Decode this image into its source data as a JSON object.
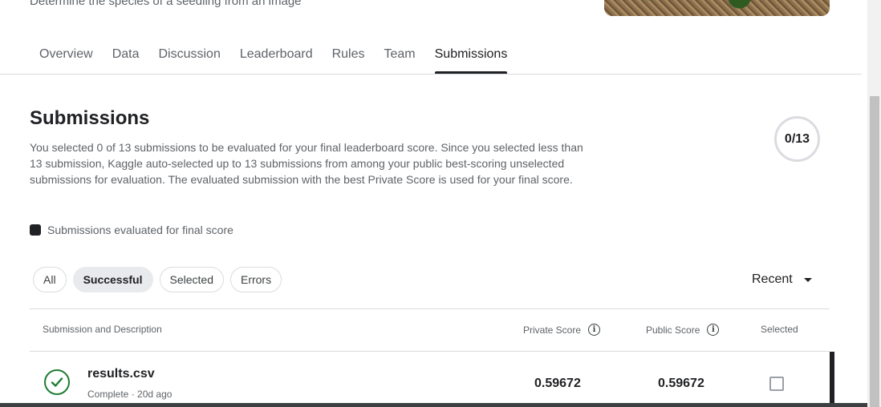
{
  "header": {
    "subtitle": "Determine the species of a seedling from an image"
  },
  "tabs": [
    {
      "label": "Overview"
    },
    {
      "label": "Data"
    },
    {
      "label": "Discussion"
    },
    {
      "label": "Leaderboard"
    },
    {
      "label": "Rules"
    },
    {
      "label": "Team"
    },
    {
      "label": "Submissions",
      "active": true
    }
  ],
  "submissions": {
    "title": "Submissions",
    "description": "You selected 0 of 13 submissions to be evaluated for your final leaderboard score. Since you selected less than 13 submission, Kaggle auto-selected up to 13 submissions from among your public best-scoring unselected submissions for evaluation. The evaluated submission with the best Private Score is used for your final score.",
    "counter": "0/13",
    "legend_label": "Submissions evaluated for final score"
  },
  "filters": {
    "chips": [
      "All",
      "Successful",
      "Selected",
      "Errors"
    ],
    "active": "Successful",
    "sort_label": "Recent"
  },
  "table": {
    "headers": {
      "submission": "Submission and Description",
      "private": "Private Score",
      "public": "Public Score",
      "selected": "Selected"
    },
    "rows": [
      {
        "filename": "results.csv",
        "status": "Complete",
        "time": "· 20d ago",
        "private_score": "0.59672",
        "public_score": "0.59672",
        "selected": false
      }
    ]
  },
  "colors": {
    "success": "#1e7d32",
    "text_primary": "#202124",
    "text_secondary": "#5f6368",
    "divider": "#dadce0"
  },
  "icons": [
    "check-circle-icon",
    "info-icon",
    "caret-down-icon"
  ]
}
